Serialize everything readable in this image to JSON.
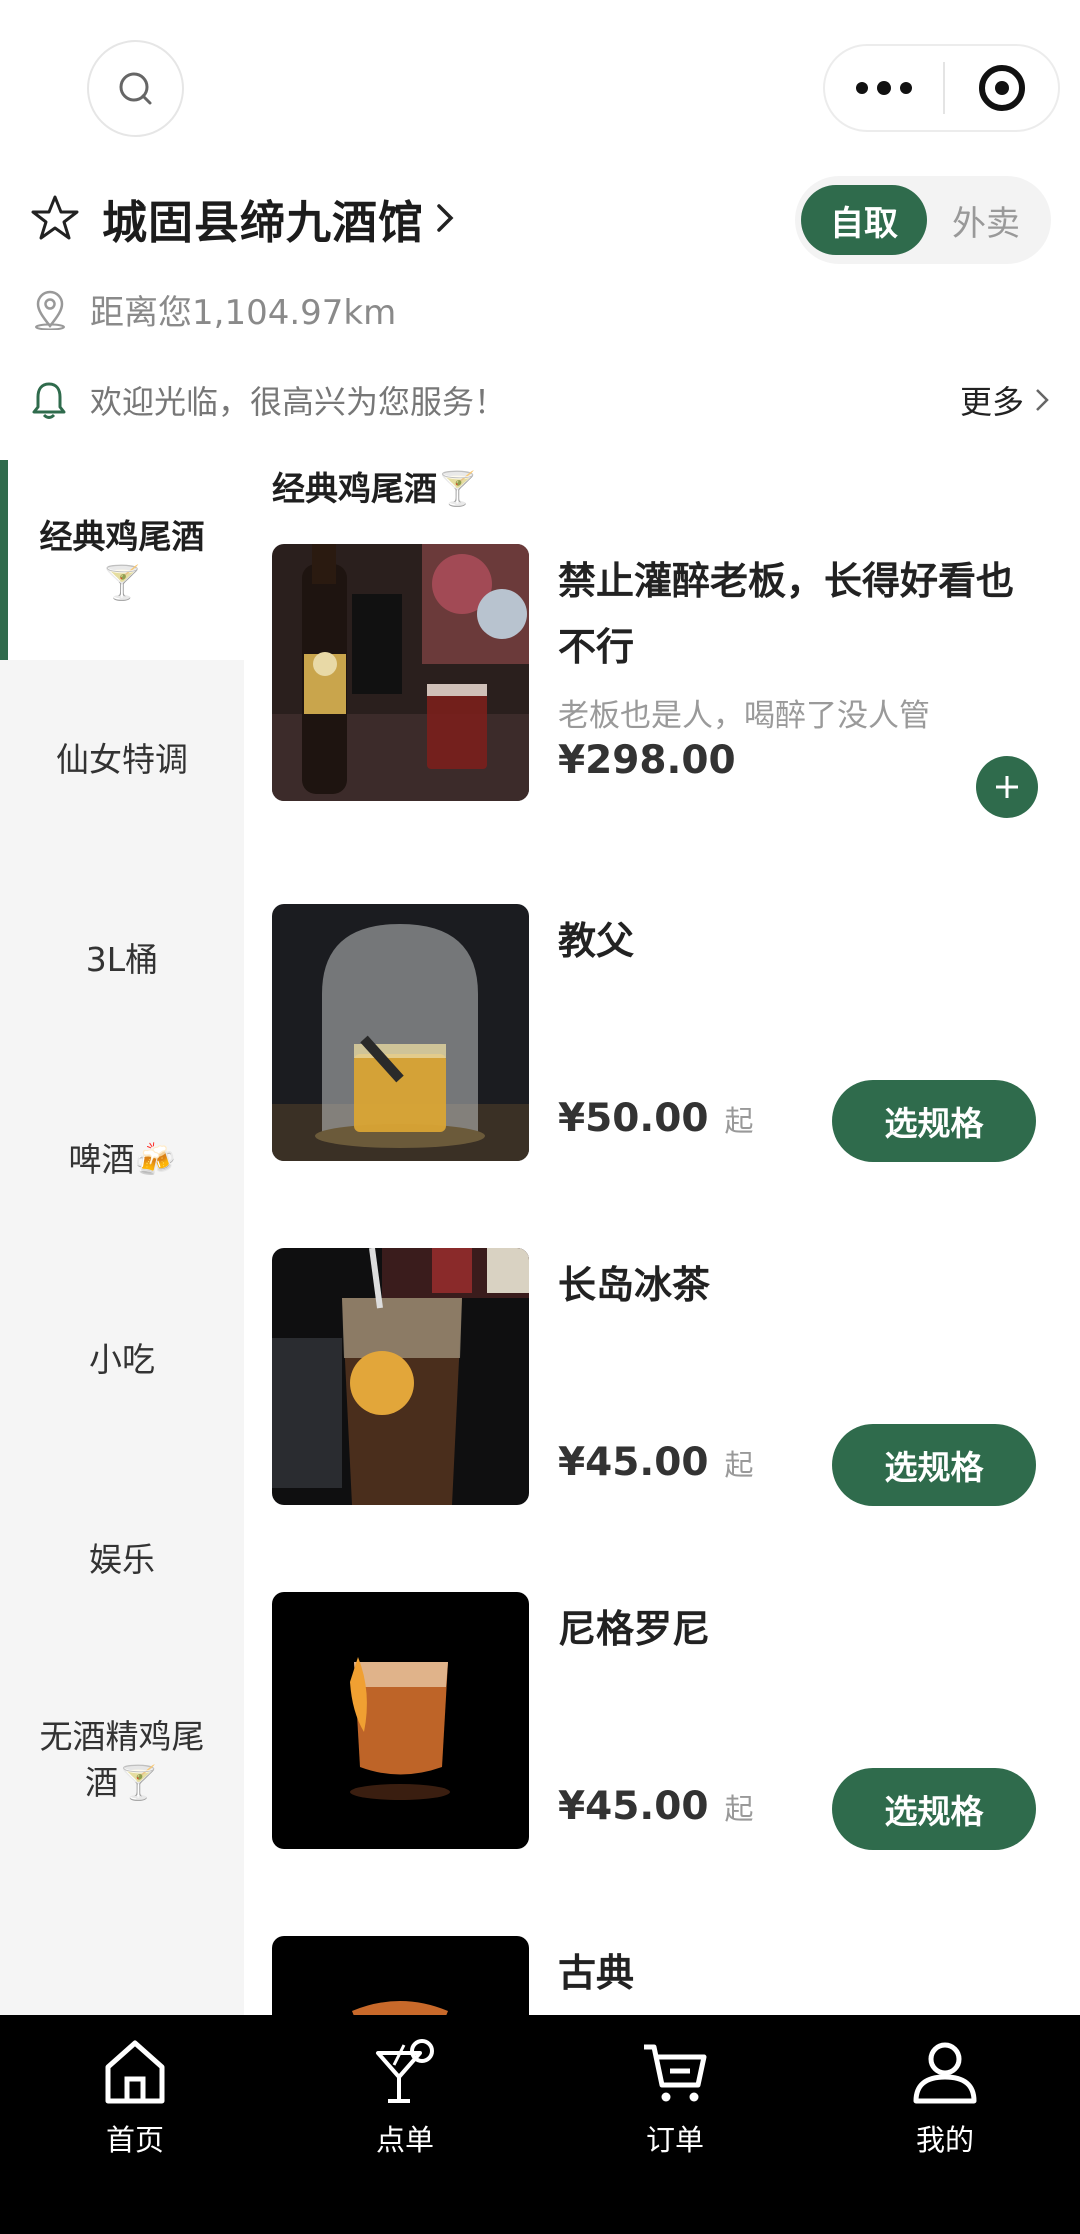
{
  "colors": {
    "accent": "#2f6b4c",
    "tabbar_bg": "#000000"
  },
  "shop": {
    "name": "城固县缔九酒馆",
    "distance": "距离您1,104.97km",
    "notice": "欢迎光临，很高兴为您服务！",
    "more": "更多"
  },
  "mode": {
    "pickup": "自取",
    "delivery": "外卖"
  },
  "categories": [
    {
      "label": "经典鸡尾酒🍸"
    },
    {
      "label": "仙女特调"
    },
    {
      "label": "3L桶"
    },
    {
      "label": "啤酒🍻"
    },
    {
      "label": "小吃"
    },
    {
      "label": "娱乐"
    },
    {
      "label": "无酒精鸡尾酒🍸"
    }
  ],
  "section": {
    "title": "经典鸡尾酒🍸"
  },
  "products": [
    {
      "name": "禁止灌醉老板，长得好看也不行",
      "desc": "老板也是人，喝醉了没人管",
      "price": "¥298.00"
    },
    {
      "name": "教父",
      "price": "¥50.00",
      "suffix": "起",
      "button": "选规格"
    },
    {
      "name": "长岛冰茶",
      "price": "¥45.00",
      "suffix": "起",
      "button": "选规格"
    },
    {
      "name": "尼格罗尼",
      "price": "¥45.00",
      "suffix": "起",
      "button": "选规格"
    },
    {
      "name": "古典"
    }
  ],
  "tabs": [
    {
      "label": "首页",
      "icon": "home-icon"
    },
    {
      "label": "点单",
      "icon": "cocktail-icon"
    },
    {
      "label": "订单",
      "icon": "cart-icon"
    },
    {
      "label": "我的",
      "icon": "user-icon"
    }
  ]
}
